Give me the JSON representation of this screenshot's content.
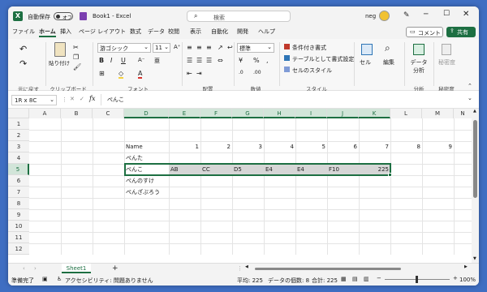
{
  "titlebar": {
    "autosave_label": "自動保存",
    "toggle_state": "オフ",
    "doc_title": "Book1 - Excel",
    "search_placeholder": "検索",
    "user": "neg"
  },
  "tabs": [
    "ファイル",
    "ホーム",
    "挿入",
    "ページ レイアウト",
    "数式",
    "データ",
    "校閲",
    "表示",
    "自動化",
    "開発",
    "ヘルプ"
  ],
  "active_tab": "ホーム",
  "actions": {
    "comment_label": "コメント",
    "share_label": "共有"
  },
  "ribbon": {
    "font_name": "游ゴシック",
    "font_size": "11",
    "number_format": "標準",
    "paste_label": "貼り付け",
    "cond_format_label": "条件付き書式",
    "table_format_label": "テーブルとして書式設定",
    "cell_style_label": "セルのスタイル",
    "cells_label": "セル",
    "edit_label": "編集",
    "analysis_label": "データ分析",
    "sensitivity_label": "秘密度",
    "groups": {
      "undo": "元に戻す",
      "clipboard": "クリップボード",
      "font": "フォント",
      "align": "配置",
      "number": "数値",
      "style": "スタイル",
      "analysis": "分析",
      "sensitivity": "秘密度"
    }
  },
  "formula": {
    "namebox": "1R x 8C",
    "fx": "fx",
    "content": "ぺんこ"
  },
  "grid": {
    "columns": [
      "A",
      "B",
      "C",
      "D",
      "E",
      "F",
      "G",
      "H",
      "I",
      "J",
      "K",
      "L",
      "M",
      "N"
    ],
    "rows": [
      "1",
      "2",
      "3",
      "4",
      "5",
      "6",
      "7",
      "8",
      "9",
      "10",
      "11",
      "12"
    ],
    "cells": {
      "D3": "Name",
      "E3": "1",
      "F3": "2",
      "G3": "3",
      "H3": "4",
      "I3": "5",
      "J3": "6",
      "K3": "7",
      "L3": "8",
      "M3": "9",
      "D4": "ぺんた",
      "D5": "ぺんこ",
      "E5": "AB",
      "F5": "CC",
      "G5": "D5",
      "H5": "E4",
      "I5": "E4",
      "J5": "F10",
      "K5": "225",
      "D6": "ぺんのすけ",
      "D7": "ぺんざぶろう"
    }
  },
  "sheets": [
    "Sheet1"
  ],
  "status": {
    "ready": "準備完了",
    "accessibility": "アクセシビリティ: 問題ありません",
    "average": "平均: 225",
    "count": "データの個数: 8",
    "sum": "合計: 225",
    "zoom": "100%"
  }
}
